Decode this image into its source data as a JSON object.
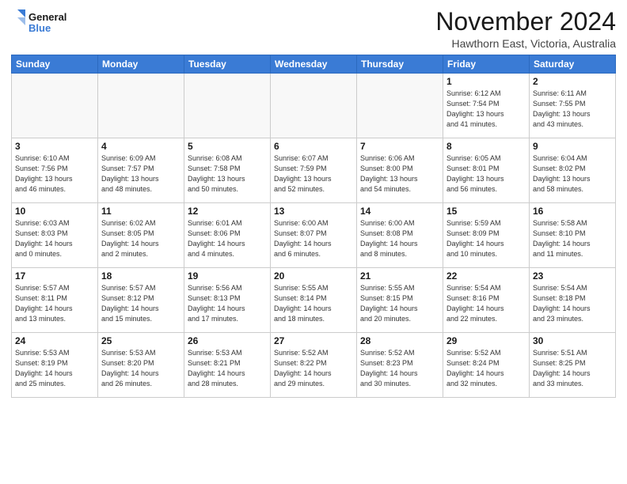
{
  "logo": {
    "line1": "General",
    "line2": "Blue"
  },
  "title": "November 2024",
  "location": "Hawthorn East, Victoria, Australia",
  "days_of_week": [
    "Sunday",
    "Monday",
    "Tuesday",
    "Wednesday",
    "Thursday",
    "Friday",
    "Saturday"
  ],
  "weeks": [
    [
      {
        "day": "",
        "info": ""
      },
      {
        "day": "",
        "info": ""
      },
      {
        "day": "",
        "info": ""
      },
      {
        "day": "",
        "info": ""
      },
      {
        "day": "",
        "info": ""
      },
      {
        "day": "1",
        "info": "Sunrise: 6:12 AM\nSunset: 7:54 PM\nDaylight: 13 hours\nand 41 minutes."
      },
      {
        "day": "2",
        "info": "Sunrise: 6:11 AM\nSunset: 7:55 PM\nDaylight: 13 hours\nand 43 minutes."
      }
    ],
    [
      {
        "day": "3",
        "info": "Sunrise: 6:10 AM\nSunset: 7:56 PM\nDaylight: 13 hours\nand 46 minutes."
      },
      {
        "day": "4",
        "info": "Sunrise: 6:09 AM\nSunset: 7:57 PM\nDaylight: 13 hours\nand 48 minutes."
      },
      {
        "day": "5",
        "info": "Sunrise: 6:08 AM\nSunset: 7:58 PM\nDaylight: 13 hours\nand 50 minutes."
      },
      {
        "day": "6",
        "info": "Sunrise: 6:07 AM\nSunset: 7:59 PM\nDaylight: 13 hours\nand 52 minutes."
      },
      {
        "day": "7",
        "info": "Sunrise: 6:06 AM\nSunset: 8:00 PM\nDaylight: 13 hours\nand 54 minutes."
      },
      {
        "day": "8",
        "info": "Sunrise: 6:05 AM\nSunset: 8:01 PM\nDaylight: 13 hours\nand 56 minutes."
      },
      {
        "day": "9",
        "info": "Sunrise: 6:04 AM\nSunset: 8:02 PM\nDaylight: 13 hours\nand 58 minutes."
      }
    ],
    [
      {
        "day": "10",
        "info": "Sunrise: 6:03 AM\nSunset: 8:03 PM\nDaylight: 14 hours\nand 0 minutes."
      },
      {
        "day": "11",
        "info": "Sunrise: 6:02 AM\nSunset: 8:05 PM\nDaylight: 14 hours\nand 2 minutes."
      },
      {
        "day": "12",
        "info": "Sunrise: 6:01 AM\nSunset: 8:06 PM\nDaylight: 14 hours\nand 4 minutes."
      },
      {
        "day": "13",
        "info": "Sunrise: 6:00 AM\nSunset: 8:07 PM\nDaylight: 14 hours\nand 6 minutes."
      },
      {
        "day": "14",
        "info": "Sunrise: 6:00 AM\nSunset: 8:08 PM\nDaylight: 14 hours\nand 8 minutes."
      },
      {
        "day": "15",
        "info": "Sunrise: 5:59 AM\nSunset: 8:09 PM\nDaylight: 14 hours\nand 10 minutes."
      },
      {
        "day": "16",
        "info": "Sunrise: 5:58 AM\nSunset: 8:10 PM\nDaylight: 14 hours\nand 11 minutes."
      }
    ],
    [
      {
        "day": "17",
        "info": "Sunrise: 5:57 AM\nSunset: 8:11 PM\nDaylight: 14 hours\nand 13 minutes."
      },
      {
        "day": "18",
        "info": "Sunrise: 5:57 AM\nSunset: 8:12 PM\nDaylight: 14 hours\nand 15 minutes."
      },
      {
        "day": "19",
        "info": "Sunrise: 5:56 AM\nSunset: 8:13 PM\nDaylight: 14 hours\nand 17 minutes."
      },
      {
        "day": "20",
        "info": "Sunrise: 5:55 AM\nSunset: 8:14 PM\nDaylight: 14 hours\nand 18 minutes."
      },
      {
        "day": "21",
        "info": "Sunrise: 5:55 AM\nSunset: 8:15 PM\nDaylight: 14 hours\nand 20 minutes."
      },
      {
        "day": "22",
        "info": "Sunrise: 5:54 AM\nSunset: 8:16 PM\nDaylight: 14 hours\nand 22 minutes."
      },
      {
        "day": "23",
        "info": "Sunrise: 5:54 AM\nSunset: 8:18 PM\nDaylight: 14 hours\nand 23 minutes."
      }
    ],
    [
      {
        "day": "24",
        "info": "Sunrise: 5:53 AM\nSunset: 8:19 PM\nDaylight: 14 hours\nand 25 minutes."
      },
      {
        "day": "25",
        "info": "Sunrise: 5:53 AM\nSunset: 8:20 PM\nDaylight: 14 hours\nand 26 minutes."
      },
      {
        "day": "26",
        "info": "Sunrise: 5:53 AM\nSunset: 8:21 PM\nDaylight: 14 hours\nand 28 minutes."
      },
      {
        "day": "27",
        "info": "Sunrise: 5:52 AM\nSunset: 8:22 PM\nDaylight: 14 hours\nand 29 minutes."
      },
      {
        "day": "28",
        "info": "Sunrise: 5:52 AM\nSunset: 8:23 PM\nDaylight: 14 hours\nand 30 minutes."
      },
      {
        "day": "29",
        "info": "Sunrise: 5:52 AM\nSunset: 8:24 PM\nDaylight: 14 hours\nand 32 minutes."
      },
      {
        "day": "30",
        "info": "Sunrise: 5:51 AM\nSunset: 8:25 PM\nDaylight: 14 hours\nand 33 minutes."
      }
    ]
  ]
}
